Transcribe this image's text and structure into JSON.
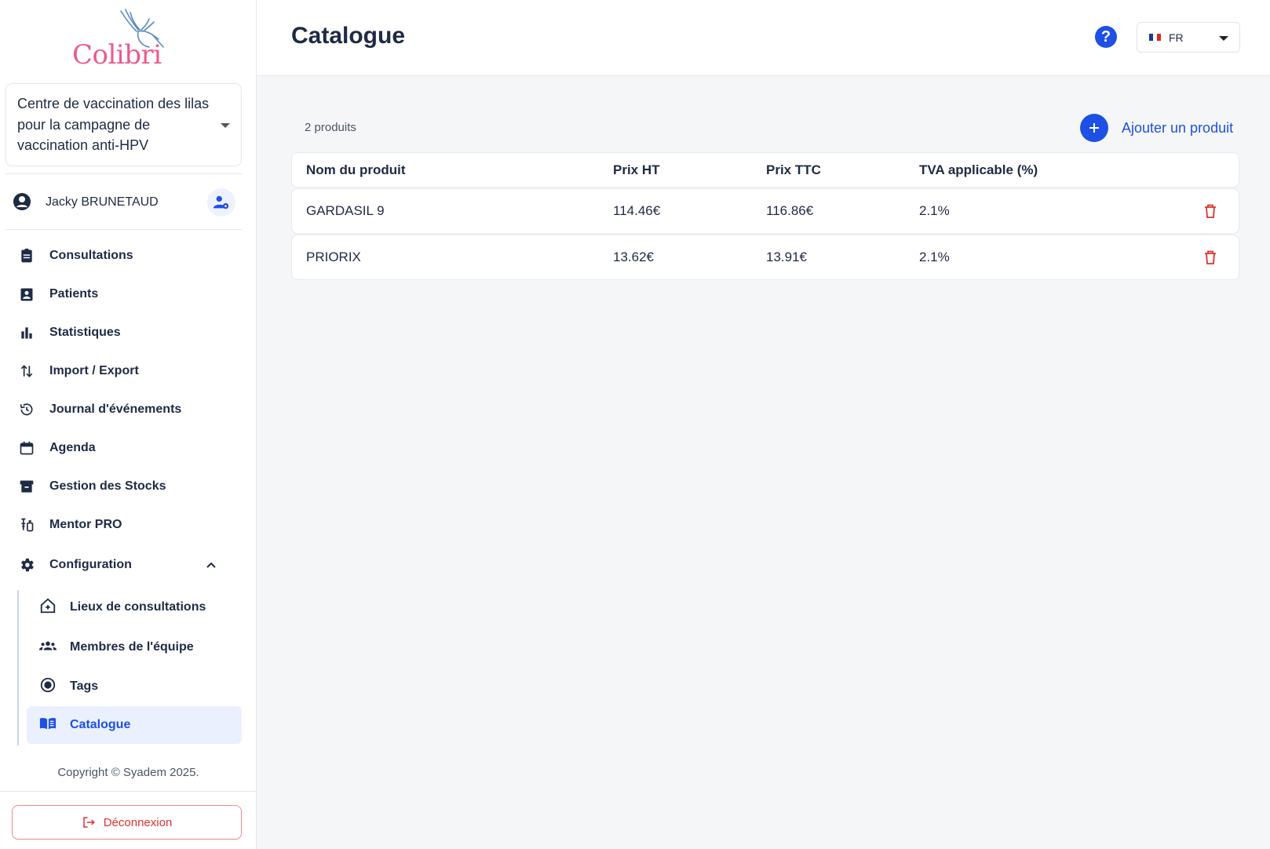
{
  "brand": {
    "logo_text": "Colibri",
    "accent": "#1e50e6",
    "logo_color": "#ec5a8c"
  },
  "center": {
    "selected": "Centre de vaccination des lilas pour la campagne de vaccination anti-HPV"
  },
  "user": {
    "name": "Jacky BRUNETAUD"
  },
  "nav": {
    "items": [
      {
        "label": "Consultations",
        "icon": "clipboard-icon"
      },
      {
        "label": "Patients",
        "icon": "patient-badge-icon"
      },
      {
        "label": "Statistiques",
        "icon": "bar-chart-icon"
      },
      {
        "label": "Import / Export",
        "icon": "swap-arrows-icon"
      },
      {
        "label": "Journal d'événements",
        "icon": "history-icon"
      },
      {
        "label": "Agenda",
        "icon": "calendar-icon"
      },
      {
        "label": "Gestion des Stocks",
        "icon": "archive-box-icon"
      },
      {
        "label": "Mentor PRO",
        "icon": "vaccine-icon"
      },
      {
        "label": "Configuration",
        "icon": "gear-icon"
      }
    ],
    "sub_items": [
      {
        "label": "Lieux de consultations",
        "icon": "home-plus-icon"
      },
      {
        "label": "Membres de l'équipe",
        "icon": "group-icon"
      },
      {
        "label": "Tags",
        "icon": "radio-circle-icon"
      },
      {
        "label": "Catalogue",
        "icon": "book-icon",
        "active": true
      }
    ]
  },
  "footer": {
    "copyright": "Copyright © Syadem 2025.",
    "logout_label": "Déconnexion"
  },
  "header": {
    "title": "Catalogue",
    "help_label": "?",
    "language": "FR"
  },
  "catalogue": {
    "count_label": "2 produits",
    "add_label": "Ajouter un produit",
    "columns": [
      "Nom du produit",
      "Prix HT",
      "Prix TTC",
      "TVA applicable (%)"
    ],
    "rows": [
      [
        "GARDASIL 9",
        "114.46€",
        "116.86€",
        "2.1%"
      ],
      [
        "PRIORIX",
        "13.62€",
        "13.91€",
        "2.1%"
      ]
    ]
  }
}
